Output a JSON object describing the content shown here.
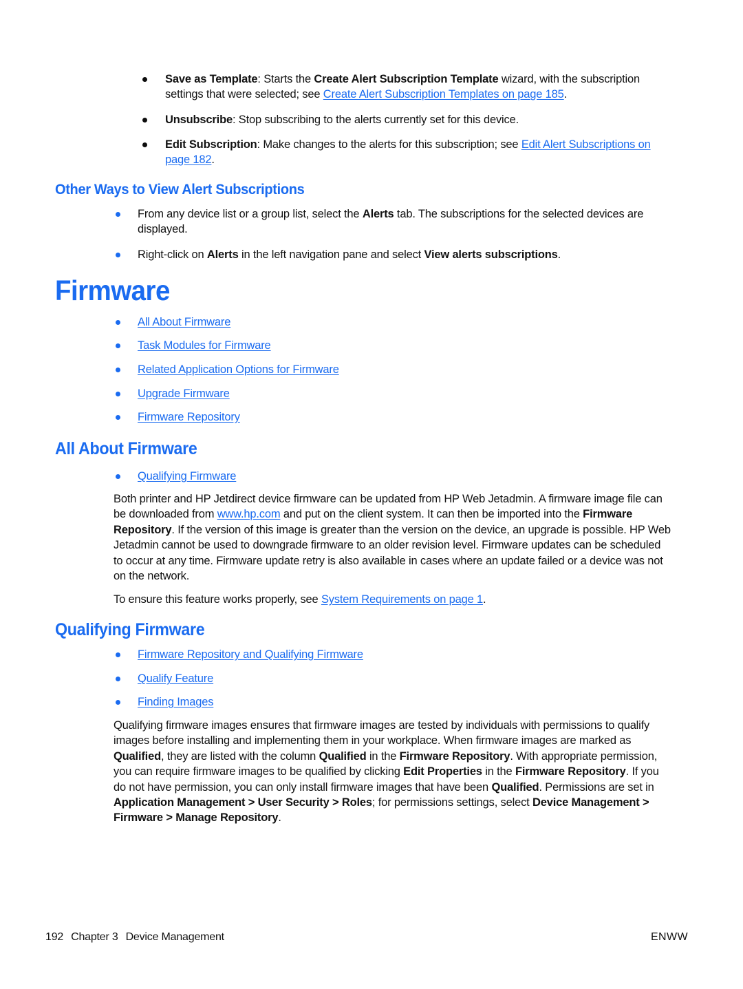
{
  "page": {
    "number": "192",
    "chapter": "Chapter 3",
    "chapter_title": "Device Management",
    "locale_code": "ENWW"
  },
  "colors": {
    "link": "#1a6bf0",
    "heading": "#1a6bf0",
    "body": "#121212"
  },
  "top_bullets": [
    {
      "term": "Save as Template",
      "t1": ": Starts the ",
      "bold2": "Create Alert Subscription Template",
      "t2": " wizard, with the subscription settings that were selected; see ",
      "link": "Create Alert Subscription Templates on page 185",
      "t3": "."
    },
    {
      "term": "Unsubscribe",
      "t1": ": Stop subscribing to the alerts currently set for this device.",
      "bold2": "",
      "t2": "",
      "link": "",
      "t3": ""
    },
    {
      "term": "Edit Subscription",
      "t1": ": Make changes to the alerts for this subscription; see ",
      "bold2": "",
      "t2": "",
      "link": "Edit Alert Subscriptions on page 182",
      "t3": "."
    }
  ],
  "other_ways": {
    "heading": "Other Ways to View Alert Subscriptions",
    "bullets": [
      {
        "t1": "From any device list or a group list, select the ",
        "b1": "Alerts",
        "t2": " tab. The subscriptions for the selected devices are displayed.",
        "b2": "",
        "t3": ""
      },
      {
        "t1": "Right-click on ",
        "b1": "Alerts",
        "t2": " in the left navigation pane and select ",
        "b2": "View alerts subscriptions",
        "t3": "."
      }
    ]
  },
  "firmware": {
    "heading": "Firmware",
    "links": [
      "All About Firmware",
      "Task Modules for Firmware",
      "Related Application Options for Firmware",
      "Upgrade Firmware",
      "Firmware Repository"
    ]
  },
  "all_about_firmware": {
    "heading": "All About Firmware",
    "links": [
      "Qualifying Firmware"
    ],
    "para1": {
      "t1": "Both printer and HP Jetdirect device firmware can be updated from HP Web Jetadmin. A firmware image file can be downloaded from ",
      "link1": "www.hp.com",
      "t2": " and put on the client system. It can then be imported into the ",
      "b1": "Firmware Repository",
      "t3": ". If the version of this image is greater than the version on the device, an upgrade is possible. HP Web Jetadmin cannot be used to downgrade firmware to an older revision level. Firmware updates can be scheduled to occur at any time. Firmware update retry is also available in cases where an update failed or a device was not on the network."
    },
    "para2": {
      "t1": "To ensure this feature works properly, see ",
      "link1": "System Requirements on page 1",
      "t2": "."
    }
  },
  "qualifying_firmware": {
    "heading": "Qualifying Firmware",
    "links": [
      "Firmware Repository and Qualifying Firmware",
      "Qualify Feature",
      "Finding Images"
    ],
    "para": {
      "t1": "Qualifying firmware images ensures that firmware images are tested by individuals with permissions to qualify images before installing and implementing them in your workplace. When firmware images are marked as ",
      "b1": "Qualified",
      "t2": ", they are listed with the column ",
      "b2": "Qualified",
      "t3": " in the ",
      "b3": "Firmware Repository",
      "t4": ". With appropriate permission, you can require firmware images to be qualified by clicking ",
      "b4": "Edit Properties",
      "t5": " in the ",
      "b5": "Firmware Repository",
      "t6": ". If you do not have permission, you can only install firmware images that have been ",
      "b6": "Qualified",
      "t7": ". Permissions are set in ",
      "b7": "Application Management > User Security > Roles",
      "t8": "; for permissions settings, select ",
      "b8": "Device Management > Firmware > Manage Repository",
      "t9": "."
    }
  }
}
